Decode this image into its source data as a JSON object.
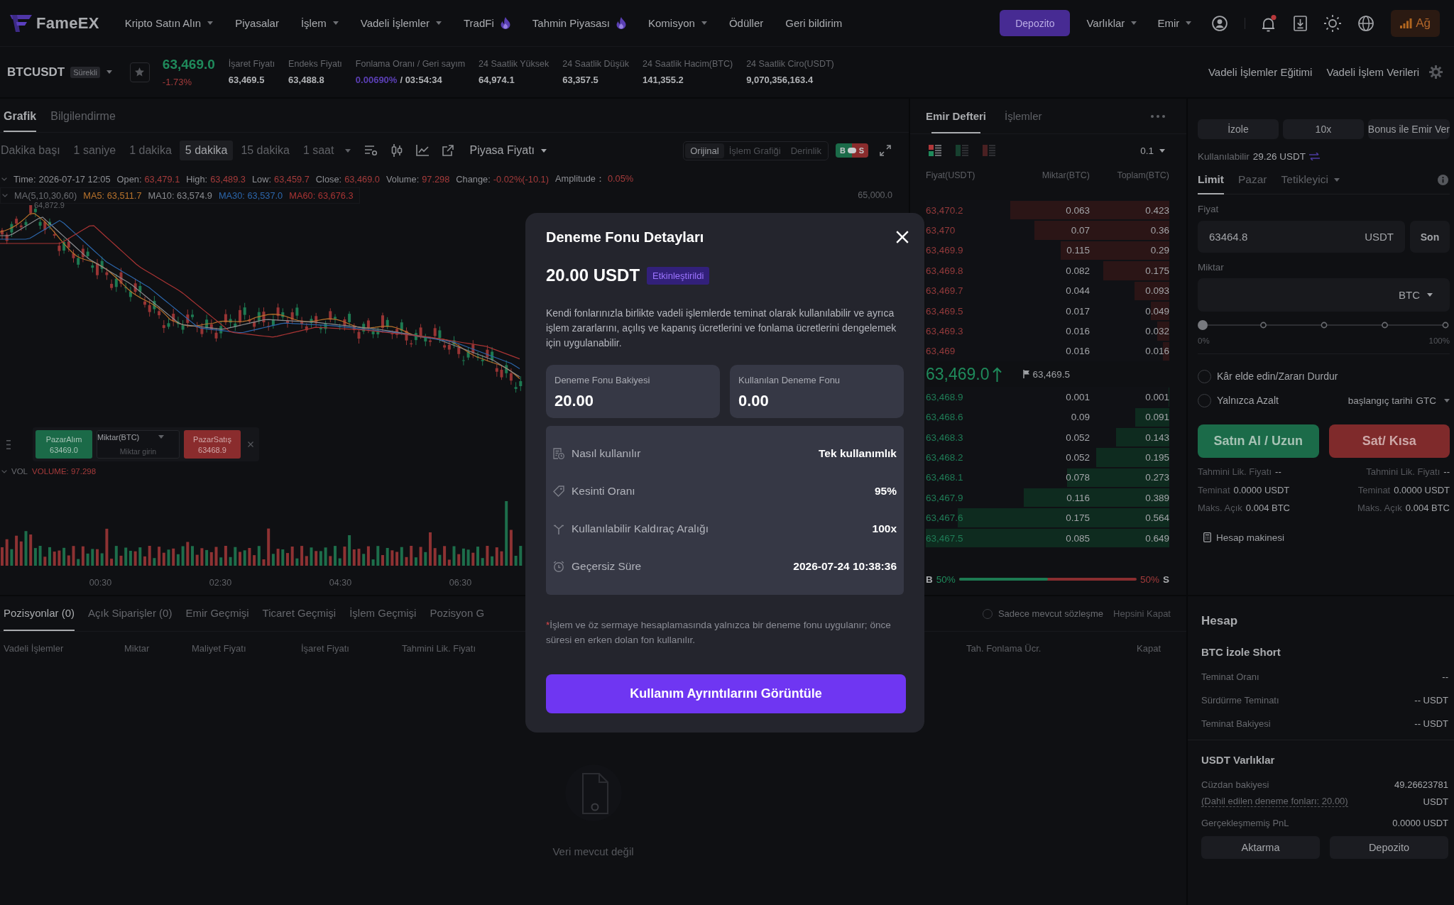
{
  "nav": {
    "logo": "FameEX",
    "menu": [
      {
        "label": "Kripto Satın Alın",
        "dropdown": true,
        "hot": false
      },
      {
        "label": "Piyasalar",
        "dropdown": false,
        "hot": false
      },
      {
        "label": "İşlem",
        "dropdown": true,
        "hot": false
      },
      {
        "label": "Vadeli İşlemler",
        "dropdown": true,
        "hot": false
      },
      {
        "label": "TradFi",
        "dropdown": false,
        "hot": true
      },
      {
        "label": "Tahmin Piyasası",
        "dropdown": false,
        "hot": true
      },
      {
        "label": "Komisyon",
        "dropdown": true,
        "hot": false
      },
      {
        "label": "Ödüller",
        "dropdown": false,
        "hot": false
      },
      {
        "label": "Geri bildirim",
        "dropdown": false,
        "hot": false
      }
    ],
    "deposit_button": "Depozito",
    "right_menu": [
      {
        "label": "Varlıklar",
        "dropdown": true
      },
      {
        "label": "Emir",
        "dropdown": true
      }
    ],
    "notifications_unread": true,
    "network_button": "Ağ"
  },
  "ticker": {
    "symbol": "BTCUSDT",
    "contract_tag": "Sürekli",
    "last_price": "63,469.0",
    "change": "-1.73%",
    "stats": [
      {
        "kind": "plain",
        "label": "İşaret Fiyatı",
        "value": "63,469.5"
      },
      {
        "kind": "plain",
        "label": "Endeks Fiyatı",
        "value": "63,488.8"
      },
      {
        "kind": "funding",
        "label": "Fonlama Oranı / Geri sayım",
        "value": "0.00690%",
        "countdown": "/ 03:54:34"
      },
      {
        "kind": "plain",
        "label": "24 Saatlik Yüksek",
        "value": "64,974.1"
      },
      {
        "kind": "plain",
        "label": "24 Saatlik Düşük",
        "value": "63,357.5"
      },
      {
        "kind": "plain",
        "label": "24 Saatlik Hacim(BTC)",
        "value": "141,355.2"
      },
      {
        "kind": "plain",
        "label": "24 Saatlik Ciro(USDT)",
        "value": "9,070,356,163.4"
      }
    ],
    "links": [
      "Vadeli İşlemler Eğitimi",
      "Vadeli İşlem Verileri"
    ]
  },
  "chart": {
    "tabs": [
      {
        "label": "Grafik",
        "selected": true
      },
      {
        "label": "Bilgilendirme",
        "selected": false
      }
    ],
    "intervals": [
      {
        "label": "Dakika başı",
        "selected": false
      },
      {
        "label": "1 saniye",
        "selected": false
      },
      {
        "label": "1 dakika",
        "selected": false
      },
      {
        "label": "5 dakika",
        "selected": true
      },
      {
        "label": "15 dakika",
        "selected": false
      },
      {
        "label": "1 saat",
        "selected": false
      }
    ],
    "price_source": "Piyasa Fiyatı",
    "views": [
      {
        "label": "Orijinal",
        "selected": true
      },
      {
        "label": "İşlem Grafiği",
        "selected": false
      },
      {
        "label": "Derinlik",
        "selected": false
      }
    ],
    "bs_toggle": [
      "B",
      "S"
    ],
    "candle_info": [
      {
        "label": "Time:",
        "value": "2026-07-17 12:05",
        "down": false
      },
      {
        "label": "Open:",
        "value": "63,479.1",
        "down": true
      },
      {
        "label": "High:",
        "value": "63,489.3",
        "down": true
      },
      {
        "label": "Low:",
        "value": "63,459.7",
        "down": true
      },
      {
        "label": "Close:",
        "value": "63,469.0",
        "down": true
      },
      {
        "label": "Volume:",
        "value": "97.298",
        "down": true
      },
      {
        "label": "Change:",
        "value": "-0.02%(-10.1)",
        "down": true
      },
      {
        "label": "Amplitude：",
        "value": "0.05%",
        "down": true
      }
    ],
    "ma_legend": {
      "title": "MA(5,10,30,60)",
      "lines": [
        {
          "label": "MA5: 63,511.7",
          "color": "#b8732c"
        },
        {
          "label": "MA10: 63,574.9",
          "color": "#8a8c90"
        },
        {
          "label": "MA30: 63,537.0",
          "color": "#2c66ab"
        },
        {
          "label": "MA60: 63,676.3",
          "color": "#a93434"
        }
      ]
    },
    "price_label": "65,000.0",
    "high_marker": "64,872.9",
    "quick_order": {
      "buy_label": "PazarAlım",
      "buy_price": "63469.0",
      "amount_label": "Miktar(BTC)",
      "amount_placeholder": "Miktar girin",
      "sell_label": "PazarSatış",
      "sell_price": "63468.9"
    },
    "volume_legend": {
      "title": "VOL",
      "value": "VOLUME: 97.298"
    },
    "time_axis": [
      "00:30",
      "02:30",
      "04:30",
      "06:30"
    ]
  },
  "order_book": {
    "tabs": [
      {
        "label": "Emir Defteri",
        "selected": true
      },
      {
        "label": "İşlemler",
        "selected": false
      }
    ],
    "layouts": [
      {
        "kind": "both",
        "selected": true
      },
      {
        "kind": "bids",
        "selected": false
      },
      {
        "kind": "asks",
        "selected": false
      }
    ],
    "precision": "0.1",
    "columns": [
      "Fiyat(USDT)",
      "Miktar(BTC)",
      "Toplam(BTC)"
    ],
    "asks": [
      {
        "price": "63,470.2",
        "amount": "0.063",
        "total": "0.423",
        "level": 0.652
      },
      {
        "price": "63,470",
        "amount": "0.07",
        "total": "0.36",
        "level": 0.555
      },
      {
        "price": "63,469.9",
        "amount": "0.115",
        "total": "0.29",
        "level": 0.447
      },
      {
        "price": "63,469.8",
        "amount": "0.082",
        "total": "0.175",
        "level": 0.27
      },
      {
        "price": "63,469.7",
        "amount": "0.044",
        "total": "0.093",
        "level": 0.143
      },
      {
        "price": "63,469.5",
        "amount": "0.017",
        "total": "0.049",
        "level": 0.076
      },
      {
        "price": "63,469.3",
        "amount": "0.016",
        "total": "0.032",
        "level": 0.049
      },
      {
        "price": "63,469",
        "amount": "0.016",
        "total": "0.016",
        "level": 0.025
      }
    ],
    "last_price": "63,469.0",
    "mark_price": "63,469.5",
    "bids": [
      {
        "price": "63,468.9",
        "amount": "0.001",
        "total": "0.001",
        "level": 0.002
      },
      {
        "price": "63,468.6",
        "amount": "0.09",
        "total": "0.091",
        "level": 0.14
      },
      {
        "price": "63,468.3",
        "amount": "0.052",
        "total": "0.143",
        "level": 0.22
      },
      {
        "price": "63,468.2",
        "amount": "0.052",
        "total": "0.195",
        "level": 0.3
      },
      {
        "price": "63,468.1",
        "amount": "0.078",
        "total": "0.273",
        "level": 0.421
      },
      {
        "price": "63,467.9",
        "amount": "0.116",
        "total": "0.389",
        "level": 0.599
      },
      {
        "price": "63,467.6",
        "amount": "0.175",
        "total": "0.564",
        "level": 0.869
      },
      {
        "price": "63,467.5",
        "amount": "0.085",
        "total": "0.649",
        "level": 1
      }
    ],
    "ratio": {
      "buy_label": "B",
      "buy_pct": "50%",
      "sell_pct": "50%",
      "sell_label": "S",
      "level": 0.5
    }
  },
  "order_form": {
    "mode_buttons": [
      "İzole",
      "10x",
      "Bonus ile Emir Ver"
    ],
    "available": {
      "label": "Kullanılabilir",
      "value": "29.26 USDT"
    },
    "tabs": [
      {
        "label": "Limit",
        "selected": true,
        "dropdown": false
      },
      {
        "label": "Pazar",
        "selected": false,
        "dropdown": false
      },
      {
        "label": "Tetikleyici",
        "selected": false,
        "dropdown": true
      }
    ],
    "price": {
      "label": "Fiyat",
      "value": "63464.8",
      "unit": "USDT",
      "button": "Son"
    },
    "amount": {
      "label": "Miktar",
      "unit": "BTC"
    },
    "slider": {
      "level": 0,
      "min_label": "0%",
      "max_label": "100%"
    },
    "options": [
      {
        "label": "Kâr elde edin/Zararı Durdur",
        "checked": false
      },
      {
        "label": "Yalnızca Azalt",
        "checked": false
      }
    ],
    "time_in_force": {
      "label": "başlangıç tarihi",
      "value": "GTC"
    },
    "buy_button": "Satın Al / Uzun",
    "sell_button": "Sat/ Kısa",
    "buy_info": [
      {
        "label": "Tahmini Lik. Fiyatı",
        "value": "--"
      },
      {
        "label": "Teminat",
        "value": "0.0000 USDT"
      },
      {
        "label": "Maks. Açık",
        "value": "0.004 BTC"
      }
    ],
    "sell_info": [
      {
        "label": "Tahmini Lik. Fiyatı",
        "value": "--"
      },
      {
        "label": "Teminat",
        "value": "0.0000 USDT"
      },
      {
        "label": "Maks. Açık",
        "value": "0.004 BTC"
      }
    ],
    "calculator": "Hesap makinesi"
  },
  "positions": {
    "tabs": [
      {
        "label": "Pozisyonlar (0)",
        "selected": true
      },
      {
        "label": "Açık Siparişler (0)",
        "selected": false
      },
      {
        "label": "Emir Geçmişi",
        "selected": false
      },
      {
        "label": "Ticaret Geçmişi",
        "selected": false
      },
      {
        "label": "İşlem Geçmişi",
        "selected": false
      },
      {
        "label": "Pozisyon G",
        "selected": false
      }
    ],
    "current_only": {
      "label": "Sadece mevcut sözleşme",
      "checked": false
    },
    "close_all": "Hepsini Kapat",
    "columns": [
      "Vadeli İşlemler",
      "Miktar",
      "Maliyet Fiyatı",
      "İşaret Fiyatı",
      "Tahmini Lik. Fiyatı",
      "Tah. Fonlama Ücr.",
      "Kapat"
    ],
    "empty_text": "Veri mevcut değil"
  },
  "account": {
    "title": "Hesap",
    "position_title": "BTC İzole Short",
    "position_rows": [
      {
        "label": "Teminat Oranı",
        "value": "--"
      },
      {
        "label": "Sürdürme Teminatı",
        "value": "-- USDT"
      },
      {
        "label": "Teminat Bakiyesi",
        "value": "-- USDT"
      }
    ],
    "assets_title": "USDT Varlıklar",
    "wallet": {
      "label": "Cüzdan bakiyesi",
      "value": "49.26623781",
      "note": "(Dahil edilen deneme fonları: 20.00)",
      "unit": "USDT"
    },
    "pnl": {
      "label": "Gerçekleşmemiş PnL",
      "value": "0.0000 USDT"
    },
    "buttons": [
      "Aktarma",
      "Depozito"
    ]
  },
  "modal": {
    "title": "Deneme Fonu Detayları",
    "amount": "20.00 USDT",
    "status": "Etkinleştirildi",
    "description": "Kendi fonlarınızla birlikte vadeli işlemlerde teminat olarak kullanılabilir ve ayrıca işlem zararlarını, açılış ve kapanış ücretlerini ve fonlama ücretlerini dengelemek için uygulanabilir.",
    "stats": [
      {
        "label": "Deneme Fonu Bakiyesi",
        "value": "20.00"
      },
      {
        "label": "Kullanılan Deneme Fonu",
        "value": "0.00"
      }
    ],
    "details": [
      {
        "kind": "usage",
        "label": "Nasıl kullanılır",
        "value": "Tek kullanımlık"
      },
      {
        "kind": "discount",
        "label": "Kesinti Oranı",
        "value": "95%"
      },
      {
        "kind": "leverage",
        "label": "Kullanılabilir Kaldıraç Aralığı",
        "value": "100x"
      },
      {
        "kind": "expiry",
        "label": "Geçersiz Süre",
        "value": "2026-07-24 10:38:36"
      }
    ],
    "footnote_mark": "*",
    "footnote": "İşlem ve öz sermaye hesaplamasında yalnızca bir deneme fonu uygulanır; önce süresi en erken dolan fon kullanılır.",
    "button": "Kullanım Ayrıntılarını Görüntüle"
  }
}
